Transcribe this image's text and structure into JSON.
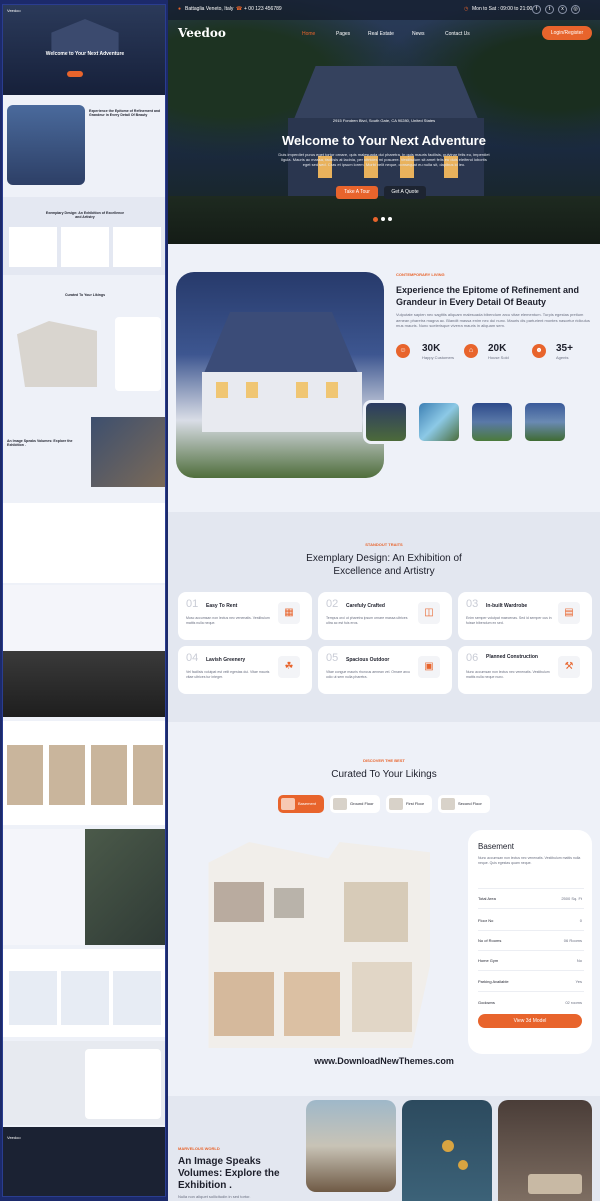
{
  "topbar": {
    "location": "Battaglia Veneto, Italy",
    "phone": "+ 00 123 456789",
    "hours": "Mon to Sat : 09:00 to 21:00"
  },
  "nav": {
    "logo": "Veedoo",
    "items": [
      "Home",
      "Pages",
      "Real Estate",
      "News",
      "Contact Us"
    ],
    "cta": "Login/Register"
  },
  "hero": {
    "address": "2915 Fondren Blvd, South Gate, CA 90280, United States",
    "title": "Welcome to Your Next Adventure",
    "text": "Duis imperdiet purus eget tortor ornare, quis malesuada dui pharetra. In quis mauris facilisis, pulvinar felis eu, imperdiet ligula. Mauris ac massa, facilisis at lacinia, per ultricies mi posuere. Vestibulum sit amet felis eu duis eleifend lobortis eget sed sed. Cras et ipsum lorem. Morbi velit neque, consequat eu nulla sit, dapibus id leo.",
    "btn1": "Take A Tour",
    "btn2": "Get A Quote"
  },
  "about": {
    "eyebrow": "CONTEMPORARY LIVING",
    "title": "Experience the Epitome of Refinement and Grandeur in Every Detail Of Beauty",
    "text": "Vulputate sapien nec sagittis aliquam malesuada bibendum arcu vitae elementum. Turpis egestas pretium aenean pharetra magna ac. Blandit massa enim nec dui nunc. Mauris dis parturient montes nascetur ridiculus mus mauris. Nunc scelerisque viverra mauris in aliquam sem.",
    "stats": [
      {
        "value": "30K",
        "label": "Happy Customers"
      },
      {
        "value": "20K",
        "label": "House Sold"
      },
      {
        "value": "35+",
        "label": "Agents"
      }
    ]
  },
  "traits": {
    "eyebrow": "STANDOUT TRAITS",
    "title": "Exemplary Design: An Exhibition of Excellence and Artistry",
    "items": [
      {
        "num": "01",
        "title": "Easy To Rent",
        "text": "Musc accumsan non lectus nec venenatis. Vestibulum mattis nulla neque."
      },
      {
        "num": "02",
        "title": "Carefuly Crafted",
        "text": "Tempus orci ut pharetra ipsum ornare massa ultrices ultra ac est fuis eros."
      },
      {
        "num": "03",
        "title": "In-built Wardrobe",
        "text": "Enim semper volutpat maecenas. Sed id semper cus in fuisse bibendum ex sed."
      },
      {
        "num": "04",
        "title": "Lavish Greenery",
        "text": "Vel facilisis volutpat est velit egestas dui. Vitae mauris vitae ultrices tur integer."
      },
      {
        "num": "05",
        "title": "Spacious Outdoor",
        "text": "Vitae congue mauris rhoncus aenean vel. Ornare arcu odio ut sem nulla pharetra."
      },
      {
        "num": "06",
        "title": "Planned Construction",
        "text": "Nunc accumsan non lectus nec venenatis. Vestibulum mattis nulla neque nunc."
      }
    ]
  },
  "curated": {
    "eyebrow": "DISCOVER THE BEST",
    "title": "Curated To Your Likings",
    "tabs": [
      "Basement",
      "Ground Floor",
      "First Floor",
      "Second Floor"
    ],
    "card": {
      "title": "Basement",
      "text": "Nunc accumsan non lectus nec venenatis. Vestibulum mattis nulla neque. Quis egestas quam neque.",
      "rows": [
        {
          "label": "Total Area",
          "value": "2500 Sq. Ft"
        },
        {
          "label": "Floor No",
          "value": "0"
        },
        {
          "label": "No of Rooms",
          "value": "06 Rooms"
        },
        {
          "label": "Home Gym",
          "value": "No"
        },
        {
          "label": "Parking Available",
          "value": "Yes"
        },
        {
          "label": "Godowns",
          "value": "02 rooms"
        }
      ],
      "btn": "View 3d Model"
    }
  },
  "watermark": "www.DownloadNewThemes.com",
  "gallery": {
    "eyebrow": "MARVELOUS WORLD",
    "title": "An Image Speaks Volumes: Explore the Exhibition .",
    "text": "Nulla non aliquet sollicitudin in sed tortor."
  }
}
